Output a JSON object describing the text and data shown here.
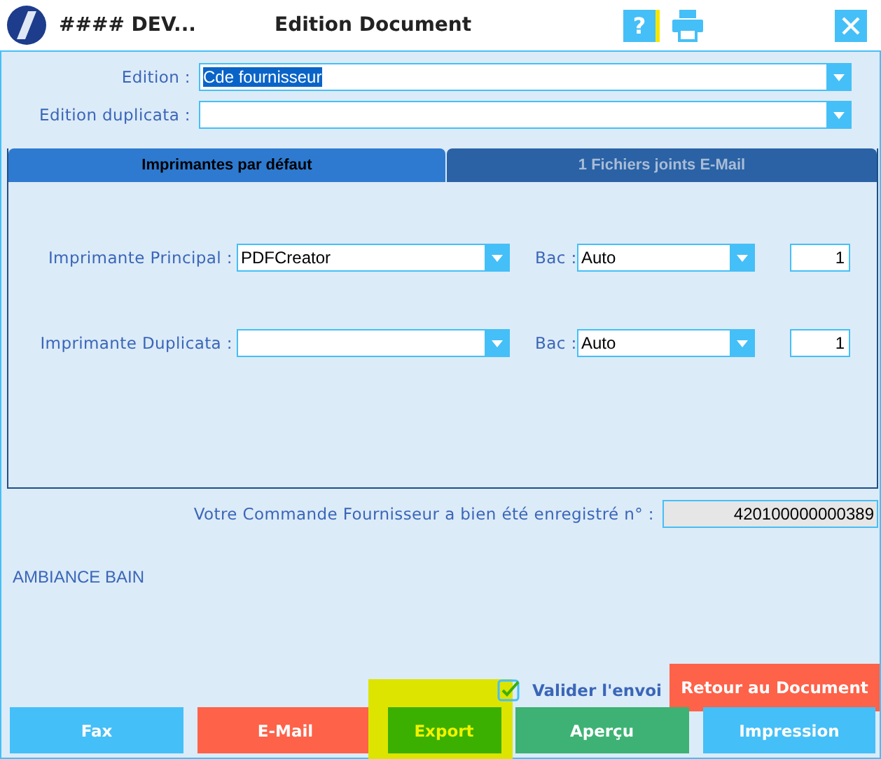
{
  "window": {
    "title": "#### DEV...",
    "heading": "Edition Document",
    "help_label": "?"
  },
  "edition": {
    "label": "Edition :",
    "value": "Cde fournisseur",
    "value_selected": true
  },
  "edition_duplicata": {
    "label": "Edition duplicata :"
  },
  "tabs": [
    {
      "label": "Imprimantes par défaut",
      "selected": true
    },
    {
      "label": "1 Fichiers joints E-Mail",
      "selected": false
    }
  ],
  "printers": [
    {
      "label": "Imprimante Principal :",
      "value": "PDFCreator",
      "bac_label": "Bac :",
      "bac": "Auto",
      "copies": "1"
    },
    {
      "label": "Imprimante Duplicata :",
      "bac_label": "Bac :",
      "bac": "Auto",
      "copies": "1"
    }
  ],
  "confirmation": {
    "label": "Votre Commande Fournisseur a bien été enregistré n° :",
    "number": "420100000000389"
  },
  "supplier": "AMBIANCE BAIN",
  "return_button": {
    "label": "Retour au Document",
    "color": "#fe6249"
  },
  "validate": {
    "label": "Valider l'envoi",
    "checked": true
  },
  "buttons": [
    {
      "label": "Fax",
      "color": "#45bff7",
      "highlighted": false
    },
    {
      "label": "E-Mail",
      "color": "#fe6249",
      "highlighted": false
    },
    {
      "label": "Export",
      "color": "#3bb000",
      "highlighted": true
    },
    {
      "label": "Aperçu",
      "color": "#3db274",
      "highlighted": false
    },
    {
      "label": "Impression",
      "color": "#45bff7",
      "highlighted": false
    }
  ]
}
